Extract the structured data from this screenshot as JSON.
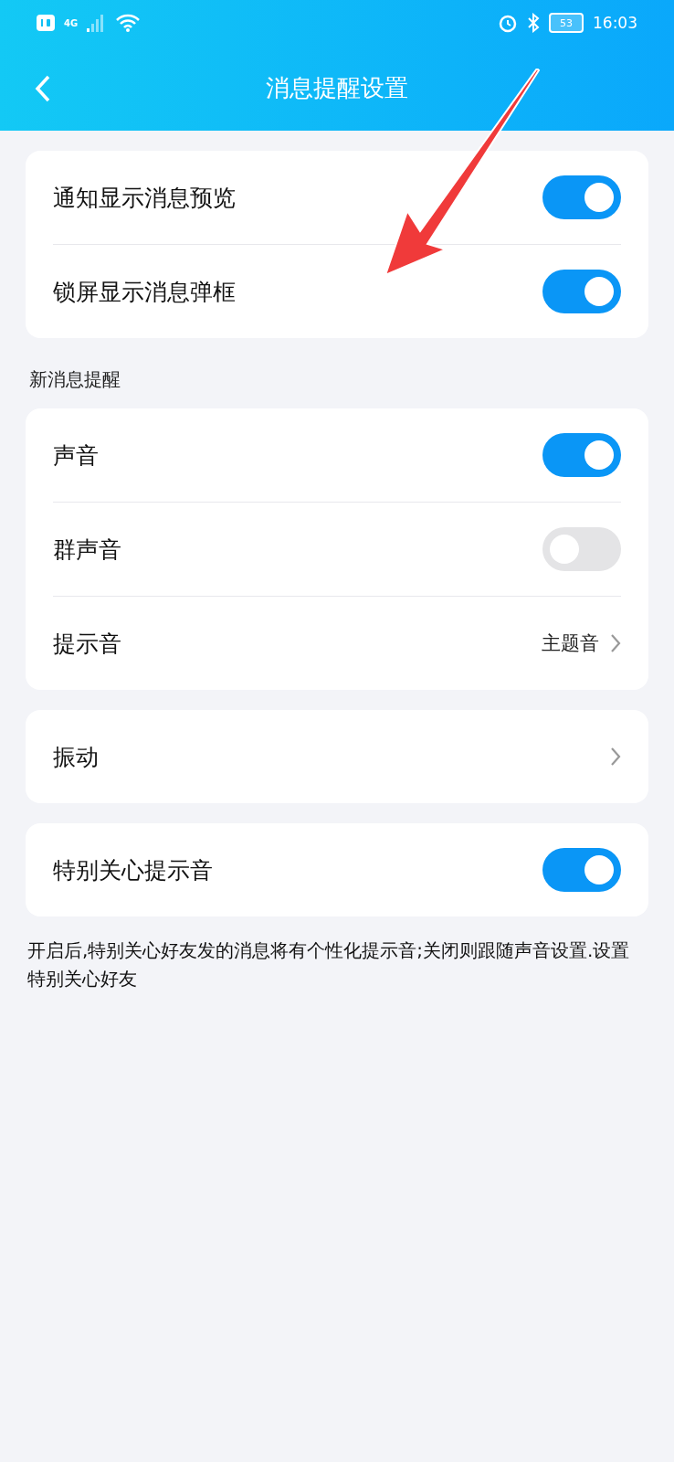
{
  "status_bar": {
    "network": "4G",
    "battery": "53",
    "time": "16:03"
  },
  "header": {
    "title": "消息提醒设置"
  },
  "sections": [
    {
      "rows": [
        {
          "kind": "toggle",
          "label": "通知显示消息预览",
          "on": true
        },
        {
          "kind": "toggle",
          "label": "锁屏显示消息弹框",
          "on": true
        }
      ]
    },
    {
      "title": "新消息提醒",
      "rows": [
        {
          "kind": "toggle",
          "label": "声音",
          "on": true
        },
        {
          "kind": "toggle",
          "label": "群声音",
          "on": false
        },
        {
          "kind": "value",
          "label": "提示音",
          "value": "主题音"
        }
      ]
    },
    {
      "rows": [
        {
          "kind": "link",
          "label": "振动"
        }
      ]
    },
    {
      "rows": [
        {
          "kind": "toggle",
          "label": "特别关心提示音",
          "on": true
        }
      ]
    }
  ],
  "footnote": "开启后,特别关心好友发的消息将有个性化提示音;关闭则跟随声音设置.设置特别关心好友"
}
